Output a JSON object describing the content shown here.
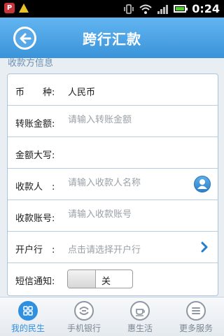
{
  "status_bar": {
    "time": "0:24"
  },
  "header": {
    "title": "跨行汇款"
  },
  "section": {
    "title": "收款方信息"
  },
  "form": {
    "currency": {
      "label": "币　　种:",
      "value": "人民币"
    },
    "amount": {
      "label": "转账金额:",
      "placeholder": "请输入转账金额"
    },
    "amount_uppercase": {
      "label": "金额大写:"
    },
    "payee": {
      "label": "收款人　:",
      "placeholder": "请输入收款人名称"
    },
    "account": {
      "label": "收款账号:",
      "placeholder": "请输入收款账号"
    },
    "bank": {
      "label": "开户行　:",
      "placeholder": "点击请选择开户行"
    },
    "sms": {
      "label": "短信通知:",
      "state": "关"
    }
  },
  "bottom_nav": {
    "items": [
      {
        "label": "我的民生",
        "icon": "grid-icon",
        "active": true
      },
      {
        "label": "手机银行",
        "icon": "bank-logo-icon",
        "active": false
      },
      {
        "label": "惠生活",
        "icon": "cup-icon",
        "active": false
      },
      {
        "label": "更多服务",
        "icon": "menu-icon",
        "active": false
      }
    ]
  },
  "colors": {
    "header_bg": "#4aa3e6",
    "accent": "#2f8fe0",
    "border": "#b7cde4"
  }
}
